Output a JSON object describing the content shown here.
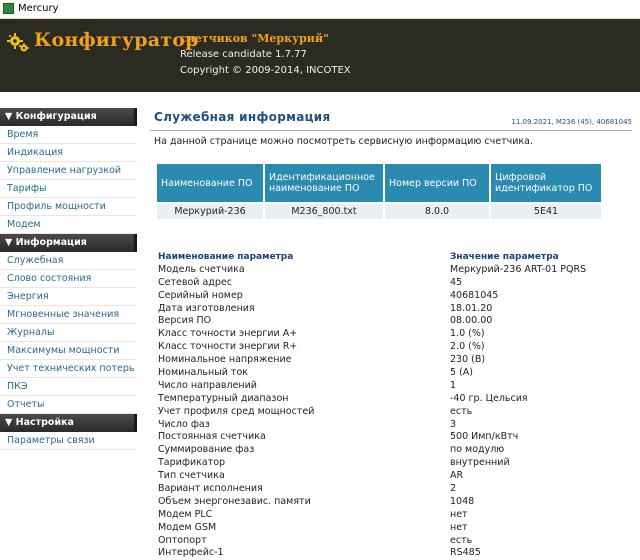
{
  "window": {
    "title": "Mercury",
    "icon": "app-icon"
  },
  "header": {
    "brand": "Конфигуратор",
    "subtitle": "счетчиков \"Меркурий\"",
    "release": "Release candidate 1.7.77",
    "copyright": "Copyright © 2009-2014, INCOTEX",
    "logo_icon": "gear-icon",
    "colors": {
      "band": "#2b2b22",
      "brand": "#f0a020"
    }
  },
  "sidebar": {
    "sections": [
      {
        "title": "▼ Конфигурация",
        "items": [
          "Время",
          "Индикация",
          "Управление нагрузкой",
          "Тарифы",
          "Профиль мощности",
          "Модем"
        ]
      },
      {
        "title": "▼ Информация",
        "items": [
          "Служебная",
          "Слово состояния",
          "Энергия",
          "Мгновенные значения",
          "Журналы",
          "Максимумы мощности",
          "Учет технических потерь",
          "ПКЭ",
          "Отчеты"
        ]
      },
      {
        "title": "▼ Настройка",
        "items": [
          "Параметры связи"
        ]
      }
    ]
  },
  "main": {
    "title": "Служебная информация",
    "meta": "11.09.2021, M236 (45), 40681045",
    "intro": "На данной странице можно посмотреть сервисную информацию счетчика.",
    "software_table": {
      "headers": [
        "Наименование ПО",
        "Идентификационное наименование ПО",
        "Номер версии ПО",
        "Цифровой идентификатор ПО"
      ],
      "row": [
        "Меркурий-236",
        "M236_800.txt",
        "8.0.0",
        "5E41"
      ]
    },
    "params_header": {
      "name": "Наименование параметра",
      "value": "Значение параметра"
    },
    "params": [
      [
        "Модель счетчика",
        "Меркурий-236 ART-01 PQRS"
      ],
      [
        "Сетевой адрес",
        "45"
      ],
      [
        "Серийный номер",
        "40681045"
      ],
      [
        "Дата изготовления",
        "18.01.20"
      ],
      [
        "Версия ПО",
        "08.00.00"
      ],
      [
        "Класс точности энергии A+",
        "1.0 (%)"
      ],
      [
        "Класс точности энергии R+",
        "2.0 (%)"
      ],
      [
        "Номинальное напряжение",
        "230 (В)"
      ],
      [
        "Номинальный ток",
        "5 (А)"
      ],
      [
        "Число направлений",
        "1"
      ],
      [
        "Температурный диапазон",
        "-40 гр. Цельсия"
      ],
      [
        "Учет профиля сред мощностей",
        "есть"
      ],
      [
        "Число фаз",
        "3"
      ],
      [
        "Постоянная счетчика",
        "500 Имп/кВтч"
      ],
      [
        "Суммирование фаз",
        "по модулю"
      ],
      [
        "Тарификатор",
        "внутренний"
      ],
      [
        "Тип счетчика",
        "AR"
      ],
      [
        "Вариант исполнения",
        "2"
      ],
      [
        "Объем энергонезавис. памяти",
        "1048"
      ],
      [
        "Модем PLC",
        "нет"
      ],
      [
        "Модем GSM",
        "нет"
      ],
      [
        "Оптопорт",
        "есть"
      ],
      [
        "Интерфейс-1",
        "RS485"
      ]
    ]
  }
}
